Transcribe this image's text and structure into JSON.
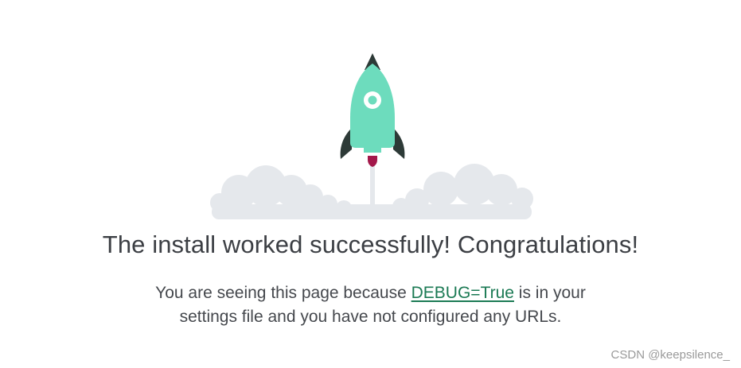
{
  "colors": {
    "rocket_body": "#6ddcbd",
    "rocket_dark": "#2d3a37",
    "flame": "#a3184a",
    "cloud": "#e5e8ec",
    "link": "#1b7a54",
    "text": "#3c3f44"
  },
  "icons": {
    "rocket": "rocket-icon",
    "clouds": "cloud-icon"
  },
  "main": {
    "title": "The install worked successfully! Congratulations!",
    "body_prefix": "You are seeing this page because ",
    "debug_link": "DEBUG=True",
    "body_suffix_1": " is in your",
    "body_line_2": "settings file and you have not configured any URLs."
  },
  "watermark": "CSDN @keepsilence_"
}
